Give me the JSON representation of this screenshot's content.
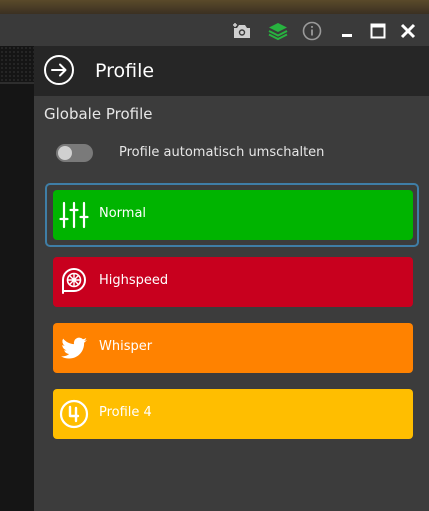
{
  "window": {
    "icons": [
      "camera-add-icon",
      "layers-icon",
      "info-icon",
      "minimize-icon",
      "maximize-icon",
      "close-icon"
    ],
    "layers_color": "#27b33f"
  },
  "panel": {
    "title": "Profile",
    "section_title": "Globale Profile",
    "auto_switch": {
      "label": "Profile automatisch umschalten",
      "on": false
    },
    "profiles": [
      {
        "label": "Normal",
        "color": "#00b400",
        "icon": "sliders-icon",
        "selected": true
      },
      {
        "label": "Highspeed",
        "color": "#c8001e",
        "icon": "turbo-icon",
        "selected": false
      },
      {
        "label": "Whisper",
        "color": "#ff8200",
        "icon": "bird-icon",
        "selected": false
      },
      {
        "label": "Profile 4",
        "color": "#ffbe00",
        "icon": "number-4-icon",
        "selected": false
      }
    ]
  }
}
